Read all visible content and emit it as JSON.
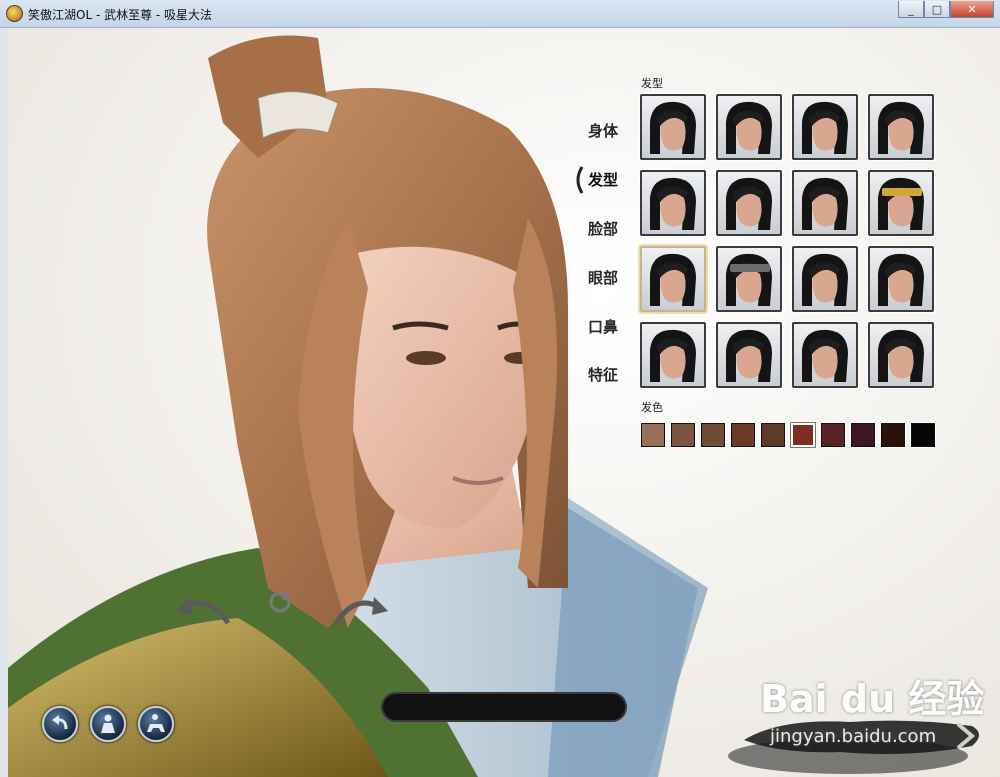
{
  "window": {
    "title": "笑傲江湖OL - 武林至尊 - 吸星大法",
    "minimize": "_",
    "maximize": "□",
    "close": "✕"
  },
  "categories": [
    {
      "label": "身体",
      "active": false
    },
    {
      "label": "发型",
      "active": true
    },
    {
      "label": "脸部",
      "active": false
    },
    {
      "label": "眼部",
      "active": false
    },
    {
      "label": "口鼻",
      "active": false
    },
    {
      "label": "特征",
      "active": false
    }
  ],
  "hair_section": {
    "label": "发型",
    "selected_index": 8,
    "styles": [
      {
        "id": "hair-1",
        "variant": "topknot-short"
      },
      {
        "id": "hair-2",
        "variant": "side-fringe"
      },
      {
        "id": "hair-3",
        "variant": "long-ponytail"
      },
      {
        "id": "hair-4",
        "variant": "slick-back"
      },
      {
        "id": "hair-5",
        "variant": "high-topknot"
      },
      {
        "id": "hair-6",
        "variant": "messy-topknot"
      },
      {
        "id": "hair-7",
        "variant": "long-sweep"
      },
      {
        "id": "hair-8",
        "variant": "yellow-headband"
      },
      {
        "id": "hair-9",
        "variant": "long-straight"
      },
      {
        "id": "hair-10",
        "variant": "grey-headband"
      },
      {
        "id": "hair-11",
        "variant": "wavy-bun"
      },
      {
        "id": "hair-12",
        "variant": "long-loose"
      },
      {
        "id": "hair-13",
        "variant": "bob-fringe"
      },
      {
        "id": "hair-14",
        "variant": "braided-long"
      },
      {
        "id": "hair-15",
        "variant": "spiky-topknot"
      },
      {
        "id": "hair-16",
        "variant": "tied-ornament"
      }
    ]
  },
  "color_section": {
    "label": "发色",
    "selected_index": 5,
    "colors": [
      "#9a6f57",
      "#7d5442",
      "#6f4c36",
      "#6b3a24",
      "#5e3a28",
      "#7e2e22",
      "#5a2226",
      "#3c1624",
      "#2a1208",
      "#050505"
    ]
  },
  "bottom_bar": {
    "name_value": "",
    "undo_icon": "undo-arrow-icon",
    "pose_icon": "character-pose-icon",
    "mount_icon": "mount-rider-icon"
  },
  "watermark": {
    "logo_text": "Bai du 经验",
    "url_text": "jingyan.baidu.com"
  },
  "palette": {
    "hair_main": "#b07a52",
    "robe_green": "#5b7f3c",
    "robe_gold": "#b39437"
  }
}
